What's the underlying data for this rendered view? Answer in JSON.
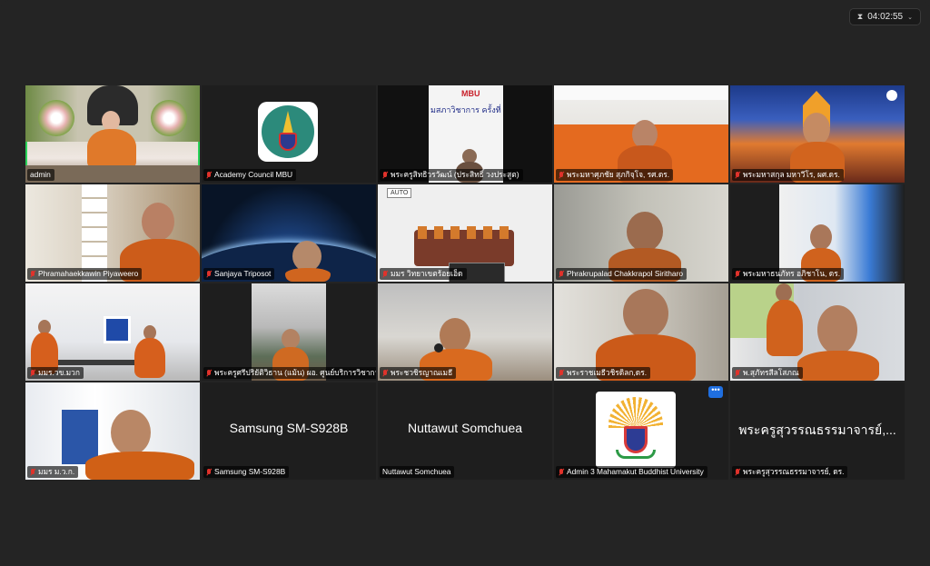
{
  "meeting": {
    "timer": "04:02:55",
    "timer_icon": "hourglass-icon"
  },
  "tiles": [
    {
      "name": "admin",
      "muted": false
    },
    {
      "name": "Academy Council MBU",
      "muted": true
    },
    {
      "name": "พระครูสิทธิวรวัฒน์ (ประสิทธิ์ วงประสูต)",
      "muted": true,
      "slide_text": "MBU",
      "slide_title": "มสภาวิชาการ ครั้งที่ ๘/"
    },
    {
      "name": "พระมหาศุภชัย สุภกิจฺโจ, รศ.ดร.",
      "muted": true
    },
    {
      "name": "พระมหาสกุล มหาวีโร, ผศ.ดร.",
      "muted": true
    },
    {
      "name": "Phramahaekkawin Piyaweero",
      "muted": true
    },
    {
      "name": "Sanjaya Triposot",
      "muted": true
    },
    {
      "name": "มมร วิทยาเขตร้อยเอ็ด",
      "muted": true,
      "room_sign": "AUTO"
    },
    {
      "name": "Phrakrupalad Chakkrapol Siritharo",
      "muted": true
    },
    {
      "name": "พระมหาธนภัทร อภิชาโน, ดร.",
      "muted": true
    },
    {
      "name": "มมร.วข.มวก",
      "muted": true
    },
    {
      "name": "พระครูศรีปริยัติวิธาน (แม้น) ผอ. ศูนย์บริการวิชาการ",
      "muted": true
    },
    {
      "name": "พระชวชิรญาณเมธี",
      "muted": true
    },
    {
      "name": "พระราชเมธีวชิรดิลก,ดร.",
      "muted": true
    },
    {
      "name": "พ.สุภัทรสีลโสภณ",
      "muted": true
    },
    {
      "name": "มมร ม.ว.ก.",
      "muted": true
    },
    {
      "name": "Samsung SM-S928B",
      "muted": true,
      "center": "Samsung SM-S928B"
    },
    {
      "name": "Nuttawut Somchuea",
      "muted": false,
      "center": "Nuttawut Somchuea"
    },
    {
      "name": "Admin 3 Mahamakut Buddhist University",
      "muted": true
    },
    {
      "name": "พระครูสุวรรณธรรมาจารย์, ดร.",
      "muted": true,
      "center": "พระครูสุวรรณธรรมาจารย์,..."
    }
  ],
  "more_button": "•••",
  "colors": {
    "active_speaker": "#2bd45a",
    "muted_mic": "#e0322b",
    "more_button": "#1f6fe0"
  }
}
